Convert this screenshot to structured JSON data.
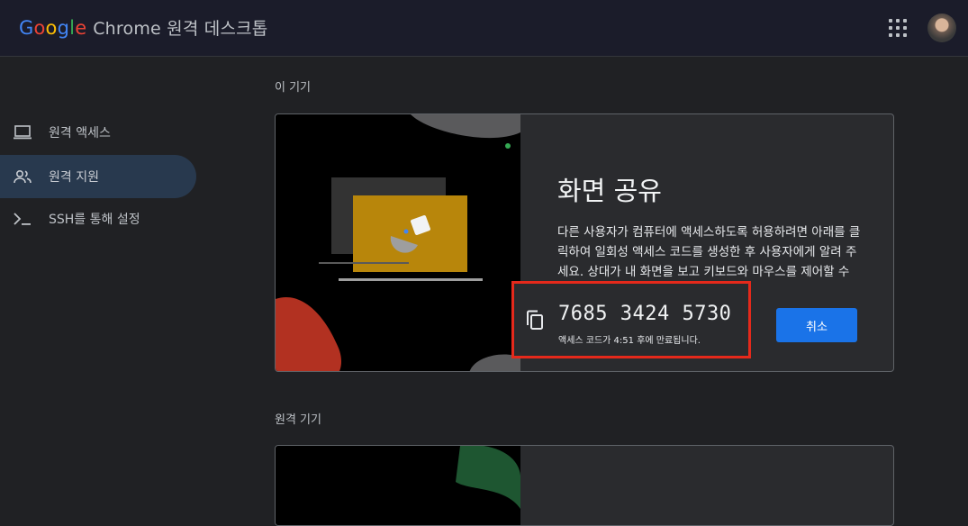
{
  "header": {
    "logo_letters": [
      "G",
      "o",
      "o",
      "g",
      "l",
      "e"
    ],
    "app_title": "Chrome 원격 데스크톱",
    "apps_icon": "apps-grid-icon",
    "avatar_icon": "user-avatar"
  },
  "sidebar": {
    "items": [
      {
        "label": "원격 액세스",
        "icon": "laptop-icon"
      },
      {
        "label": "원격 지원",
        "icon": "people-icon",
        "active": true
      },
      {
        "label": "SSH를 통해 설정",
        "icon": "terminal-icon"
      }
    ]
  },
  "main": {
    "this_device_label": "이 기기",
    "remote_devices_label": "원격 기기",
    "share": {
      "title": "화면 공유",
      "description": "다른 사용자가 컴퓨터에 액세스하도록 허용하려면 아래를 클릭하여 일회성 액세스 코드를 생성한 후 사용자에게 알려 주세요. 상대가 내 화면을 보고 키보드와 마우스를 제어할 수 있게 됩니다.",
      "access_code": "7685 3424 5730",
      "expiry_note": "액세스 코드가 4:51 후에 만료됩니다.",
      "copy_icon": "copy-icon",
      "cancel_label": "취소"
    }
  },
  "colors": {
    "accent": "#1a73e8",
    "highlight_box": "#e5291b",
    "background": "#202124",
    "card": "#2a2b2e"
  }
}
